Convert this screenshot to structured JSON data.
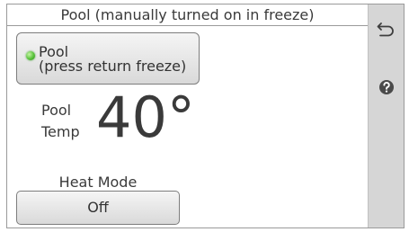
{
  "header": {
    "title": "Pool (manually turned on in freeze)"
  },
  "pool_button": {
    "line1": "Pool",
    "line2": "(press return freeze)",
    "status": "on",
    "led_color": "#4cbb2f"
  },
  "temperature": {
    "label_line1": "Pool",
    "label_line2": "Temp",
    "value": "40°"
  },
  "heat_mode": {
    "label": "Heat Mode",
    "value": "Off"
  },
  "sidebar": {
    "back_icon": "return-arrow-icon",
    "help_icon": "question-mark-icon"
  },
  "colors": {
    "text": "#3a3a3a",
    "sidebar_bg": "#d6d6d6",
    "border": "#9a9a9a"
  }
}
